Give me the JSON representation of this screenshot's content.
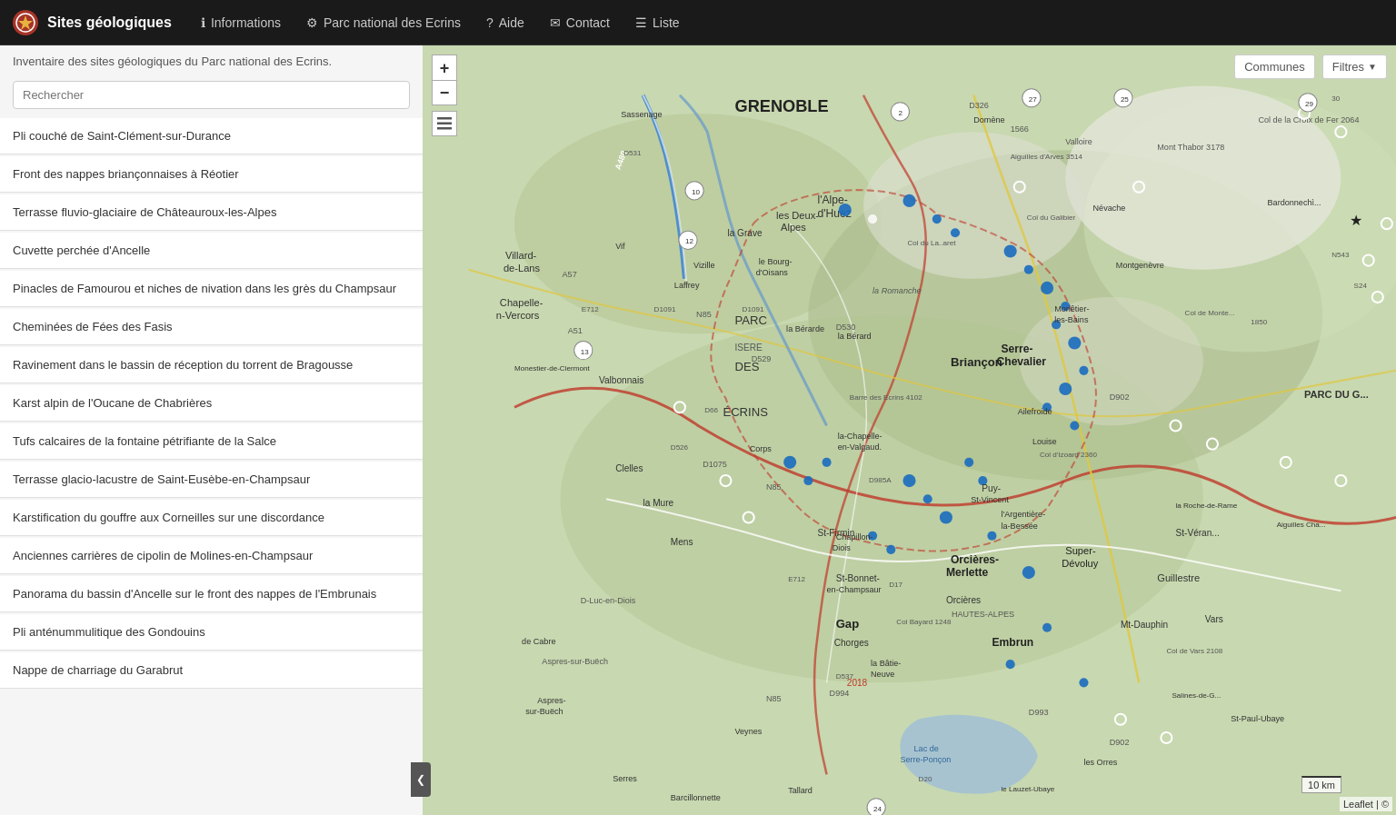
{
  "brand": {
    "icon_label": "logo",
    "title": "Sites géologiques"
  },
  "navbar": {
    "items": [
      {
        "id": "informations",
        "label": "Informations",
        "icon": "ℹ",
        "active": false
      },
      {
        "id": "parc",
        "label": "Parc national des Ecrins",
        "icon": "⚙",
        "active": false
      },
      {
        "id": "aide",
        "label": "Aide",
        "icon": "?",
        "active": false
      },
      {
        "id": "contact",
        "label": "Contact",
        "icon": "✉",
        "active": false
      },
      {
        "id": "liste",
        "label": "Liste",
        "icon": "☰",
        "active": false
      }
    ]
  },
  "sidebar": {
    "info_text": "Inventaire des sites géologiques du Parc national des Ecrins.",
    "search_placeholder": "Rechercher",
    "sites": [
      {
        "id": 1,
        "label": "Pli couché de Saint-Clément-sur-Durance"
      },
      {
        "id": 2,
        "label": "Front des nappes briançonnaises à Réotier"
      },
      {
        "id": 3,
        "label": "Terrasse fluvio-glaciaire de Châteauroux-les-Alpes"
      },
      {
        "id": 4,
        "label": "Cuvette perchée d'Ancelle"
      },
      {
        "id": 5,
        "label": "Pinacles de Famourou et niches de nivation dans les grès du Champsaur"
      },
      {
        "id": 6,
        "label": "Cheminées de Fées des Fasis"
      },
      {
        "id": 7,
        "label": "Ravinement dans le bassin de réception du torrent de Bragousse"
      },
      {
        "id": 8,
        "label": "Karst alpin de l'Oucane de Chabrières"
      },
      {
        "id": 9,
        "label": "Tufs calcaires de la fontaine pétrifiante de la Salce"
      },
      {
        "id": 10,
        "label": "Terrasse glacio-lacustre de Saint-Eusèbe-en-Champsaur"
      },
      {
        "id": 11,
        "label": "Karstification du gouffre aux Corneilles sur une discordance"
      },
      {
        "id": 12,
        "label": "Anciennes carrières de cipolin de Molines-en-Champsaur"
      },
      {
        "id": 13,
        "label": "Panorama du bassin d'Ancelle sur le front des nappes de l'Embrunais"
      },
      {
        "id": 14,
        "label": "Pli anténummulitique des Gondouins"
      },
      {
        "id": 15,
        "label": "Nappe de charriage du Garabrut"
      }
    ],
    "collapse_label": "❮"
  },
  "map": {
    "communes_label": "Communes",
    "filtres_label": "Filtres",
    "scale_label": "10 km",
    "attribution": "Leaflet | ©"
  }
}
